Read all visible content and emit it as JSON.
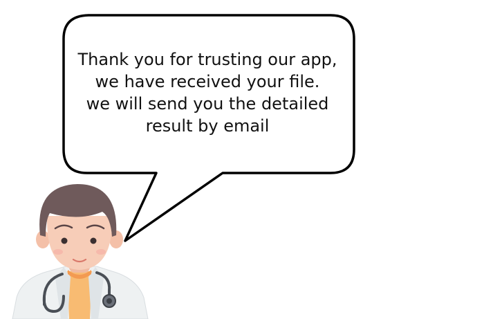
{
  "message": {
    "lines": [
      "Thank you for trusting our app,",
      "we have received your file.",
      "we will send you the detailed",
      "result by email"
    ]
  },
  "illustration": {
    "character": "doctor-avatar",
    "accessory": "stethoscope-icon",
    "colors": {
      "hair": "#6f5a5b",
      "skin": "#f7cdb8",
      "coat": "#eef1f2",
      "shirt": "#f8bb72",
      "stethoscope": "#4a4f56",
      "bubble_border": "#000000"
    }
  }
}
